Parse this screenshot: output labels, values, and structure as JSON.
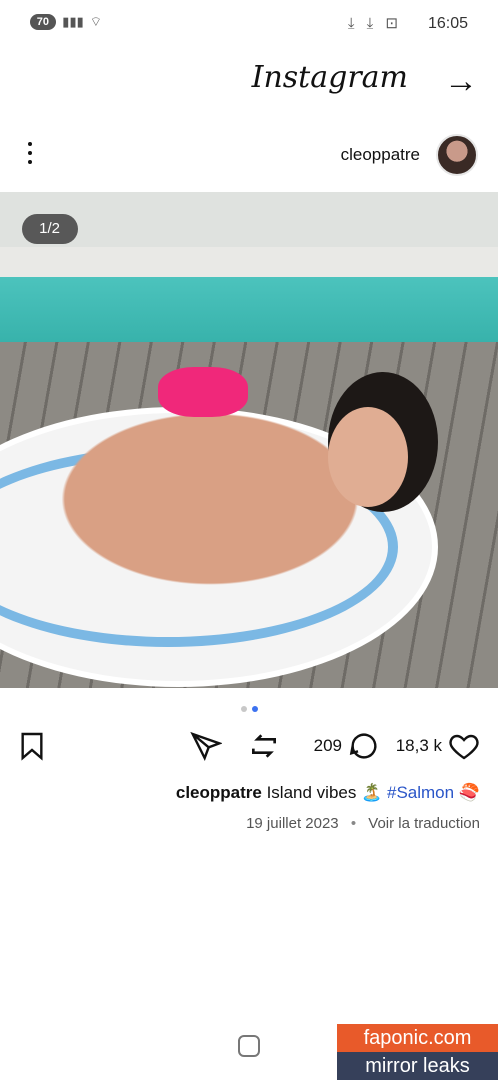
{
  "status_bar": {
    "time": "16:05",
    "battery": "70",
    "icons": [
      "screenshot-icon",
      "download-icon",
      "download-icon"
    ]
  },
  "app_bar": {
    "logo": "Instagram"
  },
  "post": {
    "username": "cleoppatre",
    "image_counter": "1/2",
    "carousel": {
      "total": 2,
      "active": 1
    },
    "likes": "18,3 k",
    "comments": "209",
    "caption_user": "cleoppatre",
    "caption_text": "Island vibes 🏝️",
    "caption_tag": "#Salmon",
    "caption_emoji": "🍣",
    "date": "19 juillet 2023",
    "translate": "Voir la traduction"
  },
  "watermark": {
    "line1": "faponic.com",
    "line2": "mirror leaks"
  },
  "colors": {
    "accent": "#3c72f0",
    "tag": "#2a55c8",
    "watermark_top": "#e85a2a",
    "watermark_bottom": "#36405a"
  }
}
